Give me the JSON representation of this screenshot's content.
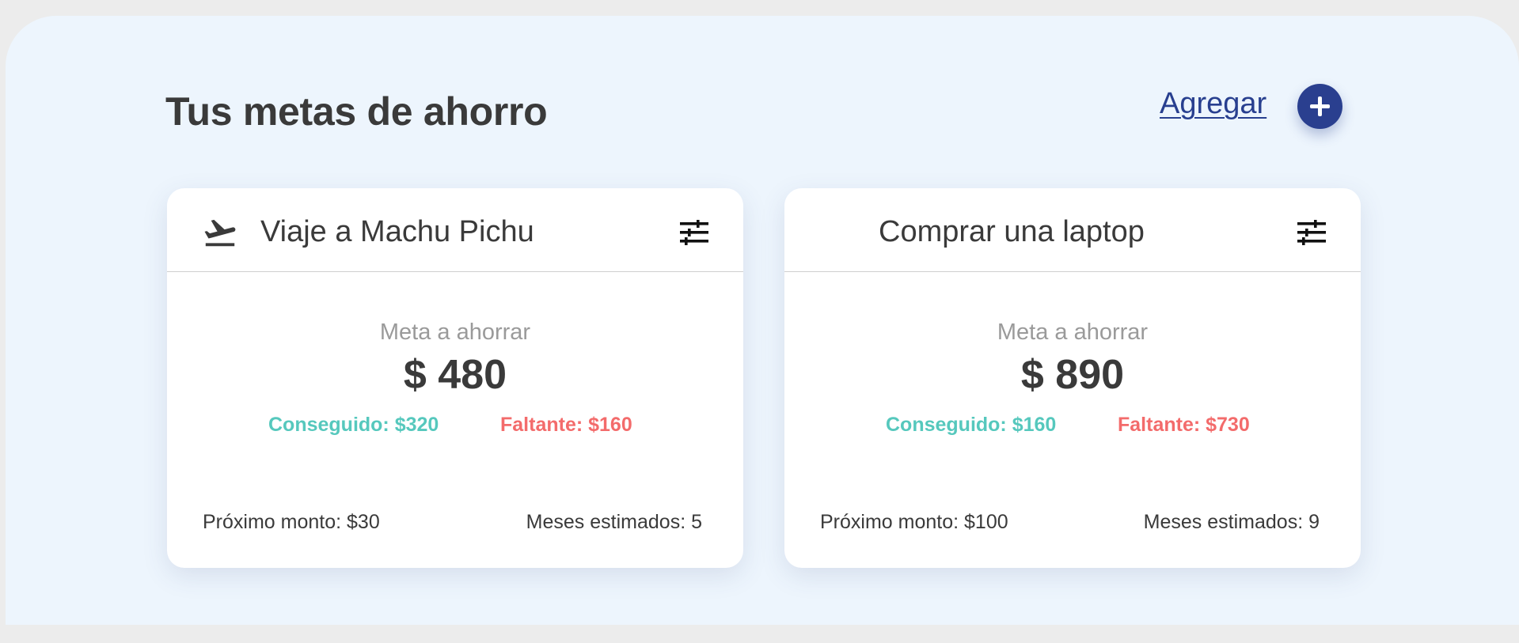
{
  "header": {
    "title": "Tus metas de ahorro",
    "add_label": "Agregar",
    "add_icon": "plus-icon"
  },
  "colors": {
    "accent": "#2a3f8f",
    "achieved": "#56c8bd",
    "missing": "#f36b6b",
    "background": "#edf5fd"
  },
  "goals": [
    {
      "title": "Viaje a Machu Pichu",
      "icon": "airplane-departure-icon",
      "goal_label": "Meta a ahorrar",
      "goal_amount": "$ 480",
      "achieved": "Conseguido: $320",
      "missing": "Faltante: $160",
      "next_amount": "Próximo monto: $30",
      "estimated_months": "Meses estimados: 5"
    },
    {
      "title": "Comprar una laptop",
      "icon": "",
      "goal_label": "Meta a ahorrar",
      "goal_amount": "$ 890",
      "achieved": "Conseguido: $160",
      "missing": "Faltante: $730",
      "next_amount": "Próximo monto: $100",
      "estimated_months": "Meses estimados: 9"
    }
  ]
}
